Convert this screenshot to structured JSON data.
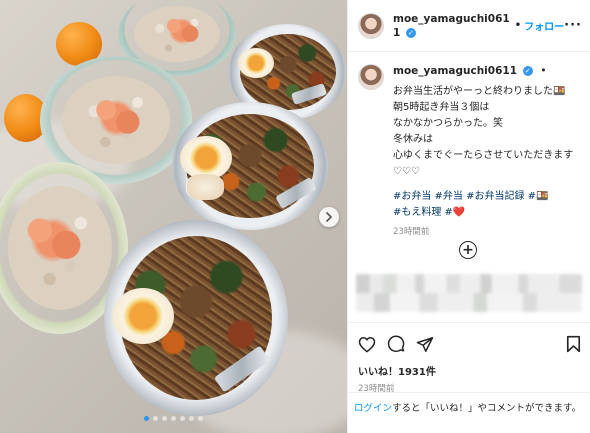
{
  "post": {
    "carousel": {
      "slide_count": 7,
      "active_index": 0
    },
    "header": {
      "username": "moe_yamaguchi0611",
      "follow_label": "フォロー",
      "separator": "•",
      "more_label": "···"
    },
    "caption": {
      "username": "moe_yamaguchi0611",
      "separator": "•",
      "text": "お弁当生活がやーっと終わりました🍱\n朝5時起き弁当３個は\nなかなかつらかった。笑\n冬休みは\n心ゆくまでぐーたらさせていただきます♡♡♡",
      "hashtags": "#お弁当 #弁当 #お弁当記録 #🍱\n#もえ料理 #❤️",
      "time_ago": "23時間前"
    },
    "actions": {
      "likes_label": "いいね！1931件",
      "time_ago": "23時間前"
    },
    "login_prompt": {
      "link_text": "ログイン",
      "rest_text": "すると「いいね！」やコメントができます。"
    },
    "colors": {
      "accent": "#0095f6",
      "verified": "#3897f0",
      "text": "#262626",
      "muted": "#8e8e8e"
    },
    "icons": [
      "chevron-right-icon",
      "verified-badge-icon",
      "more-options-icon",
      "add-comments-icon",
      "heart-icon",
      "comment-icon",
      "share-icon",
      "bookmark-icon"
    ]
  }
}
